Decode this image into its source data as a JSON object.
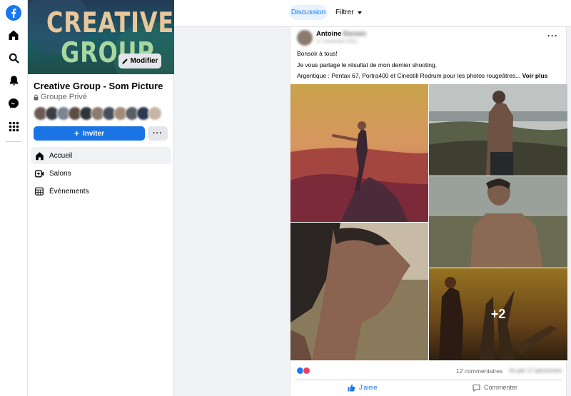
{
  "rail": {
    "icons": [
      "facebook-logo-icon",
      "home-icon",
      "search-icon",
      "notifications-bell-icon",
      "messenger-icon",
      "menu-grid-icon"
    ]
  },
  "group": {
    "cover_line1": "CREATIVE",
    "cover_line2": "GROUP",
    "modify_label": "Modifier",
    "name": "Creative Group - Som Picture",
    "privacy": "Groupe Privé",
    "invite_label": "Inviter",
    "more_label": "···",
    "member_colors": [
      "#6b5a52",
      "#3a3e42",
      "#7b8591",
      "#5d4e45",
      "#2f3438",
      "#8c7a6b",
      "#46505a",
      "#a38b79",
      "#5a5f64",
      "#2b3950",
      "#c7b5a4"
    ]
  },
  "nav": [
    {
      "label": "Accueil",
      "icon": "home-icon"
    },
    {
      "label": "Salons",
      "icon": "video-plus-icon"
    },
    {
      "label": "Évènements",
      "icon": "calendar-icon"
    }
  ],
  "tabs": {
    "discussion": "Discussion",
    "filter": "Filtrer"
  },
  "post": {
    "author_first": "Antoine",
    "author_last": "Dorsen",
    "date": "17 novembre 2021",
    "more_label": "···",
    "lines": [
      "Bonsoir à tous!",
      "Je vous partage le résultat de mon dernier shooting.",
      "Argentique : Pentax 67, Portra400 et Cinestill Redrum pour les photos rougeâtres..."
    ],
    "see_more": "Voir plus",
    "extra_photos": "+2",
    "comments": "12 commentaires",
    "shares": "Vu par 17 personnes",
    "like_label": "J'aime",
    "comment_label": "Commenter"
  },
  "colors": {
    "accent": "#1b74e4",
    "facebook_blue": "#1877f2"
  }
}
